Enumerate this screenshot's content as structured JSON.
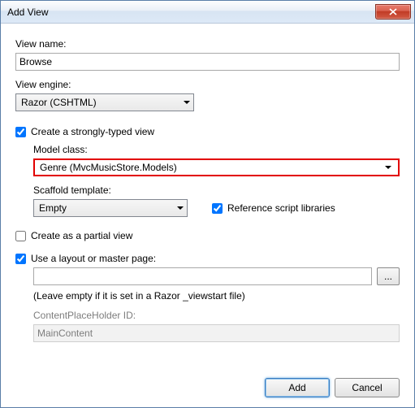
{
  "window": {
    "title": "Add View"
  },
  "labels": {
    "view_name": "View name:",
    "view_engine": "View engine:",
    "strongly_typed": "Create a strongly-typed view",
    "model_class": "Model class:",
    "scaffold_template": "Scaffold template:",
    "reference_scripts": "Reference script libraries",
    "partial_view": "Create as a partial view",
    "use_layout": "Use a layout or master page:",
    "layout_hint": "(Leave empty if it is set in a Razor _viewstart file)",
    "cph_id": "ContentPlaceHolder ID:",
    "browse": "...",
    "add": "Add",
    "cancel": "Cancel"
  },
  "values": {
    "view_name": "Browse",
    "view_engine": "Razor (CSHTML)",
    "model_class": "Genre (MvcMusicStore.Models)",
    "scaffold_template": "Empty",
    "layout_path": "",
    "cph_id": "MainContent"
  },
  "state": {
    "strongly_typed_checked": true,
    "reference_scripts_checked": true,
    "partial_view_checked": false,
    "use_layout_checked": true,
    "cph_enabled": false
  },
  "colors": {
    "highlight_border": "#e20000",
    "accent": "#3b7bbf"
  }
}
